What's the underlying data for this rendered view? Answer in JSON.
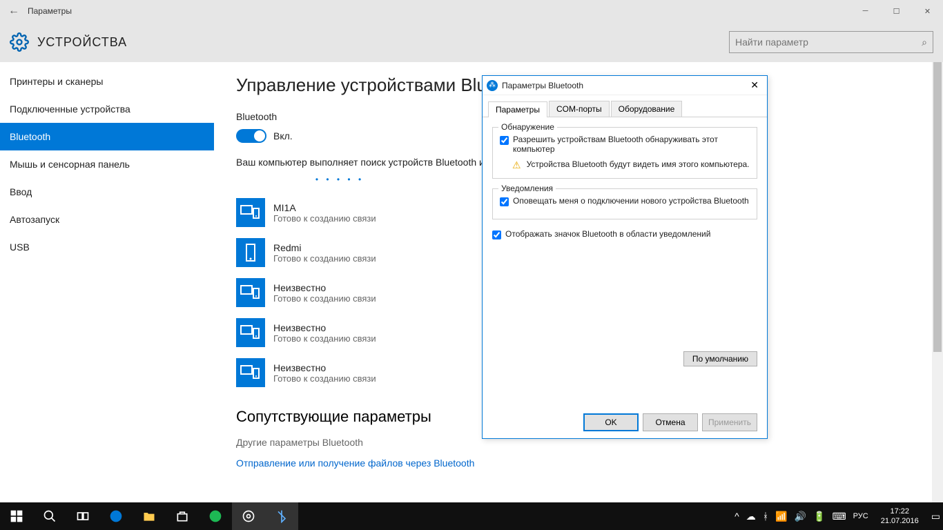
{
  "titlebar": {
    "title": "Параметры"
  },
  "header": {
    "title": "УСТРОЙСТВА",
    "search_placeholder": "Найти параметр"
  },
  "sidebar": {
    "items": [
      {
        "label": "Принтеры и сканеры"
      },
      {
        "label": "Подключенные устройства"
      },
      {
        "label": "Bluetooth"
      },
      {
        "label": "Мышь и сенсорная панель"
      },
      {
        "label": "Ввод"
      },
      {
        "label": "Автозапуск"
      },
      {
        "label": "USB"
      }
    ]
  },
  "main": {
    "heading": "Управление устройствами Bluetooth",
    "bt_label": "Bluetooth",
    "toggle_state": "Вкл.",
    "desc1": "Ваш компьютер выполняет поиск устройств Bluetooth и может быть обнаружен ими.",
    "devices": [
      {
        "name": "MI1A",
        "status": "Готово к созданию связи",
        "type": "multi"
      },
      {
        "name": "Redmi",
        "status": "Готово к созданию связи",
        "type": "phone"
      },
      {
        "name": "Неизвестно",
        "status": "Готово к созданию связи",
        "type": "multi"
      },
      {
        "name": "Неизвестно",
        "status": "Готово к созданию связи",
        "type": "multi"
      },
      {
        "name": "Неизвестно",
        "status": "Готово к созданию связи",
        "type": "multi"
      }
    ],
    "related_heading": "Сопутствующие параметры",
    "related_link1": "Другие параметры Bluetooth",
    "related_link2": "Отправление или получение файлов через Bluetooth"
  },
  "dialog": {
    "title": "Параметры Bluetooth",
    "tabs": [
      "Параметры",
      "COM-порты",
      "Оборудование"
    ],
    "group1": {
      "legend": "Обнаружение",
      "check": "Разрешить устройствам Bluetooth обнаруживать этот компьютер",
      "warn": "Устройства Bluetooth будут видеть имя этого компьютера."
    },
    "group2": {
      "legend": "Уведомления",
      "check": "Оповещать меня о подключении нового устройства Bluetooth"
    },
    "check3": "Отображать значок Bluetooth в области уведомлений",
    "defaults": "По умолчанию",
    "ok": "OK",
    "cancel": "Отмена",
    "apply": "Применить"
  },
  "taskbar": {
    "lang": "РУС",
    "time": "17:22",
    "date": "21.07.2016"
  }
}
